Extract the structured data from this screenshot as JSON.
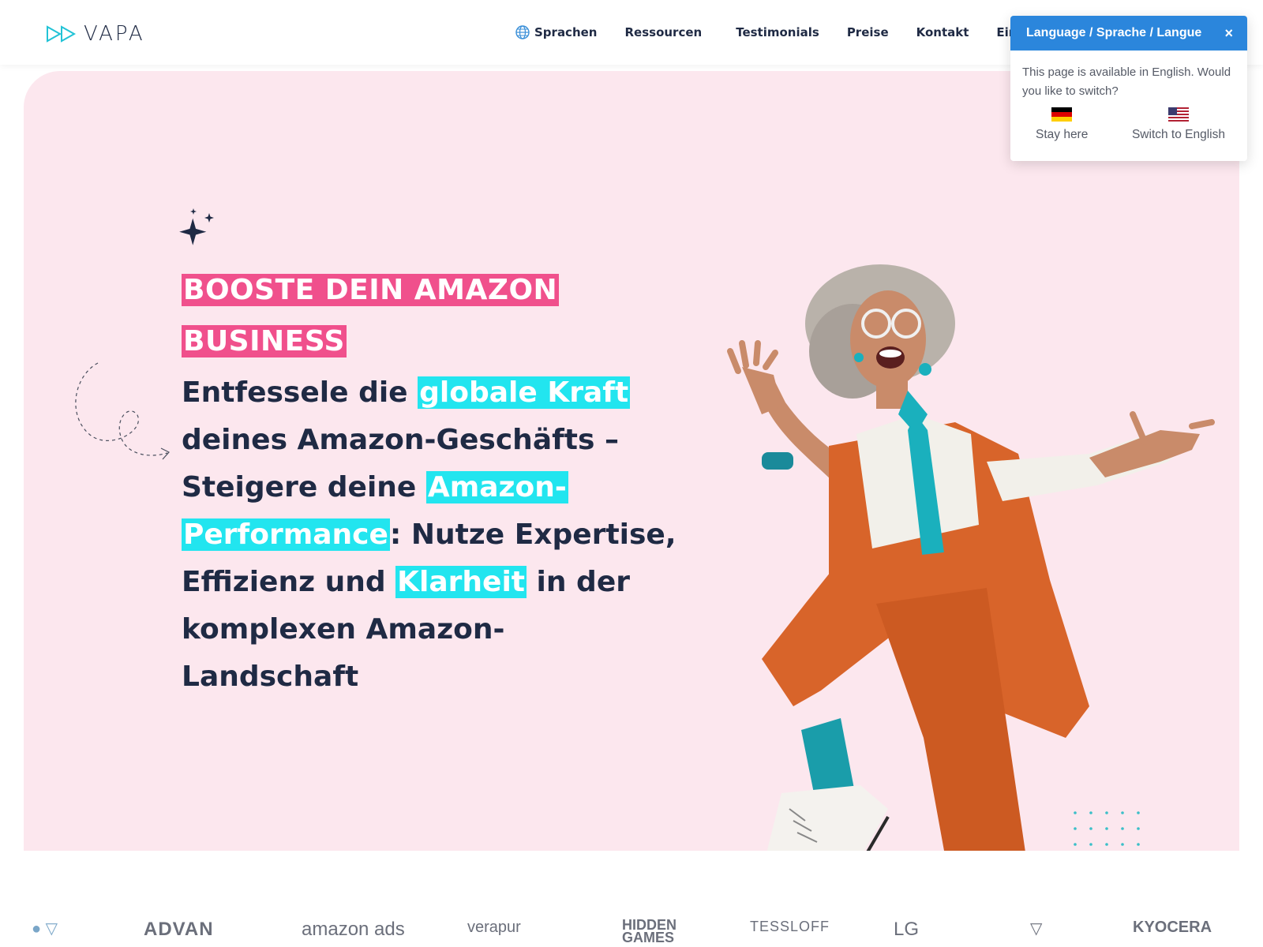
{
  "header": {
    "logo_text": "VAPA",
    "nav": [
      {
        "label": "Sprachen",
        "icon": "globe-icon"
      },
      {
        "label": "Ressourcen"
      },
      {
        "label": "Testimonials"
      },
      {
        "label": "Preise"
      },
      {
        "label": "Kontakt"
      },
      {
        "label": "Einlogge"
      }
    ]
  },
  "hero": {
    "headline_line1": "BOOSTE DEIN AMAZON",
    "headline_line2": "BUSINESS",
    "tagline": {
      "t1": "Entfessele die ",
      "h1": "globale Kraft",
      "t2": " deines Amazon-Geschäfts – Steigere deine ",
      "h2": "Amazon-Performance",
      "t3": ": Nutze Expertise, Effizienz und ",
      "h3": "Klarheit",
      "t4": " in der komplexen Amazon-Landschaft"
    },
    "colors": {
      "background": "#fce7ee",
      "pink": "#f0508c",
      "cyan": "#22e5ef",
      "text": "#1f2a44"
    }
  },
  "language_popup": {
    "title": "Language / Sprache / Langue",
    "close": "×",
    "message": "This page is available in English. Would you like to switch?",
    "stay_label": "Stay here",
    "switch_label": "Switch to English",
    "header_color": "#2b86dc"
  },
  "partner_logos": [
    "ADVAN",
    "amazon ads",
    "verapur",
    "HIDDEN GAMES",
    "TESSLOFF",
    "LG",
    "KYOCERA"
  ]
}
